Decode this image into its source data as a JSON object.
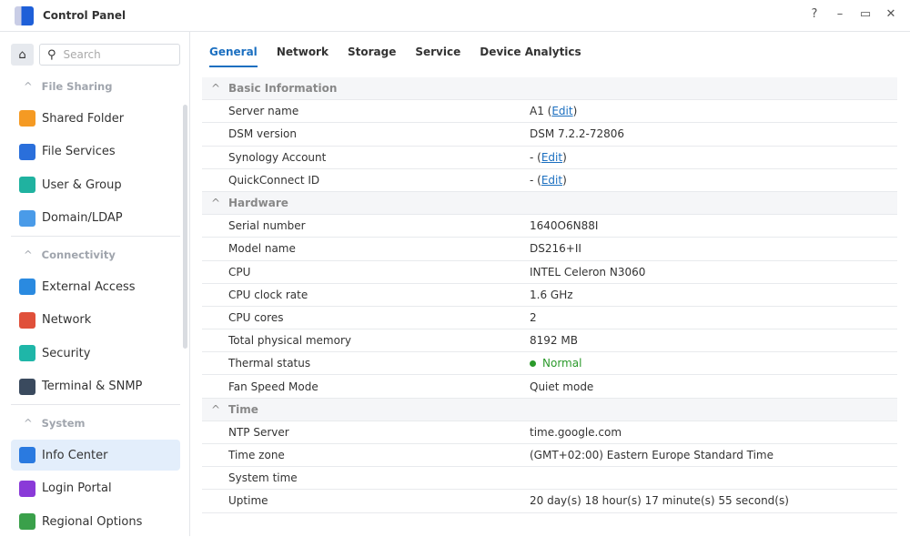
{
  "window": {
    "title": "Control Panel",
    "help": "?",
    "minimize": "–",
    "maximize": "▭",
    "close": "✕"
  },
  "sidebar": {
    "search_placeholder": "Search",
    "groups": [
      {
        "label": "File Sharing",
        "items": [
          {
            "label": "Shared Folder",
            "color": "#f59a23"
          },
          {
            "label": "File Services",
            "color": "#2a6fdb"
          },
          {
            "label": "User & Group",
            "color": "#20b2a0"
          },
          {
            "label": "Domain/LDAP",
            "color": "#4a9be8"
          }
        ]
      },
      {
        "label": "Connectivity",
        "items": [
          {
            "label": "External Access",
            "color": "#2a8ae0"
          },
          {
            "label": "Network",
            "color": "#e0503a"
          },
          {
            "label": "Security",
            "color": "#1fb6a8"
          },
          {
            "label": "Terminal & SNMP",
            "color": "#3a4a5e"
          }
        ]
      },
      {
        "label": "System",
        "items": [
          {
            "label": "Info Center",
            "color": "#2a7ae0",
            "active": true
          },
          {
            "label": "Login Portal",
            "color": "#8a3ad8"
          },
          {
            "label": "Regional Options",
            "color": "#3aa04a"
          }
        ]
      }
    ]
  },
  "tabs": [
    {
      "label": "General",
      "active": true
    },
    {
      "label": "Network"
    },
    {
      "label": "Storage"
    },
    {
      "label": "Service"
    },
    {
      "label": "Device Analytics"
    }
  ],
  "sections": [
    {
      "title": "Basic Information",
      "rows": [
        {
          "label": "Server name",
          "value": "A1",
          "edit": "Edit"
        },
        {
          "label": "DSM version",
          "value": "DSM 7.2.2-72806"
        },
        {
          "label": "Synology Account",
          "value": "-",
          "edit": "Edit"
        },
        {
          "label": "QuickConnect ID",
          "value": "-",
          "edit": "Edit"
        }
      ]
    },
    {
      "title": "Hardware",
      "rows": [
        {
          "label": "Serial number",
          "value": "1640O6N88I"
        },
        {
          "label": "Model name",
          "value": "DS216+II"
        },
        {
          "label": "CPU",
          "value": "INTEL Celeron N3060"
        },
        {
          "label": "CPU clock rate",
          "value": "1.6 GHz"
        },
        {
          "label": "CPU cores",
          "value": "2"
        },
        {
          "label": "Total physical memory",
          "value": "8192 MB"
        },
        {
          "label": "Thermal status",
          "value": "Normal",
          "status": "ok"
        },
        {
          "label": "Fan Speed Mode",
          "value": "Quiet mode"
        }
      ]
    },
    {
      "title": "Time",
      "rows": [
        {
          "label": "NTP Server",
          "value": "time.google.com"
        },
        {
          "label": "Time zone",
          "value": "(GMT+02:00) Eastern Europe Standard Time"
        },
        {
          "label": "System time",
          "value": ""
        },
        {
          "label": "Uptime",
          "value": "20 day(s) 18 hour(s) 17 minute(s) 55 second(s)"
        }
      ]
    }
  ],
  "colors": {
    "accent": "#1b6fc0",
    "ok": "#2b9a2b"
  }
}
